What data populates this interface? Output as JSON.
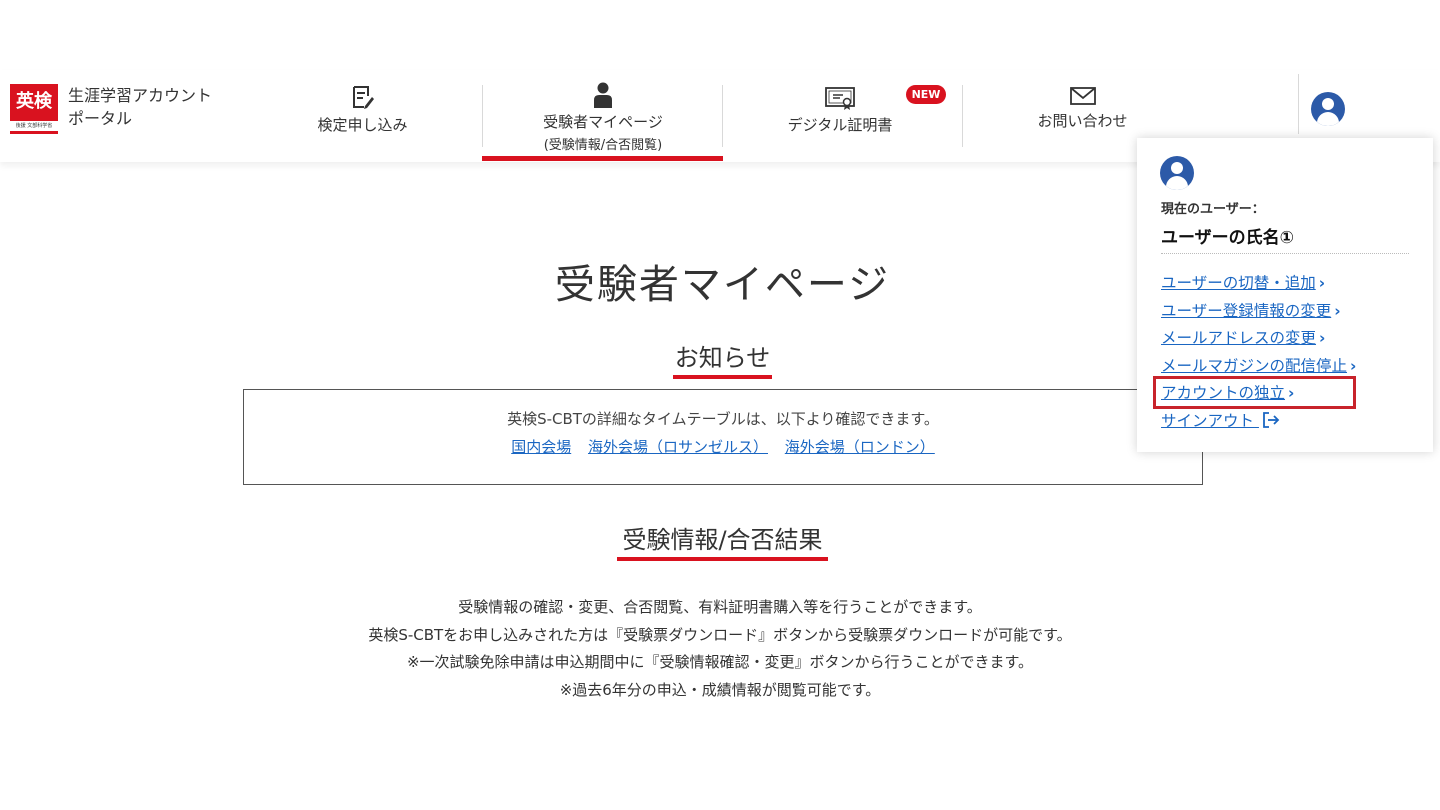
{
  "logo": {
    "text": "英検",
    "sub": "後援 文部科学省"
  },
  "portal_name": "生涯学習アカウント\nポータル",
  "nav": {
    "apply": "検定申し込み",
    "mypage": "受験者マイページ",
    "mypage_sub": "(受験情報/合否閲覧)",
    "certificate": "デジタル証明書",
    "new_badge": "NEW",
    "contact": "お問い合わせ"
  },
  "main": {
    "title": "受験者マイページ",
    "notice_heading": "お知らせ",
    "notice_text": "英検S-CBTの詳細なタイムテーブルは、以下より確認できます。",
    "notice_links": [
      "国内会場",
      "海外会場（ロサンゼルス）",
      "海外会場（ロンドン）"
    ],
    "results_heading": "受験情報/合否結果",
    "info_lines": [
      "受験情報の確認・変更、合否閲覧、有料証明書購入等を行うことができます。",
      "英検S-CBTをお申し込みされた方は『受験票ダウンロード』ボタンから受験票ダウンロードが可能です。",
      "※一次試験免除申請は申込期間中に『受験情報確認・変更』ボタンから行うことができます。",
      "※過去6年分の申込・成績情報が閲覧可能です。"
    ]
  },
  "dropdown": {
    "current_user_label": "現在のユーザー：",
    "user_name": "ユーザーの氏名①",
    "links": [
      "ユーザーの切替・追加",
      "ユーザー登録情報の変更",
      "メールアドレスの変更",
      "メールマガジンの配信停止",
      "アカウントの独立",
      "サインアウト"
    ]
  },
  "colors": {
    "accent_red": "#d9121f",
    "link_blue": "#1a66c2",
    "avatar_blue": "#2c5aa8"
  }
}
